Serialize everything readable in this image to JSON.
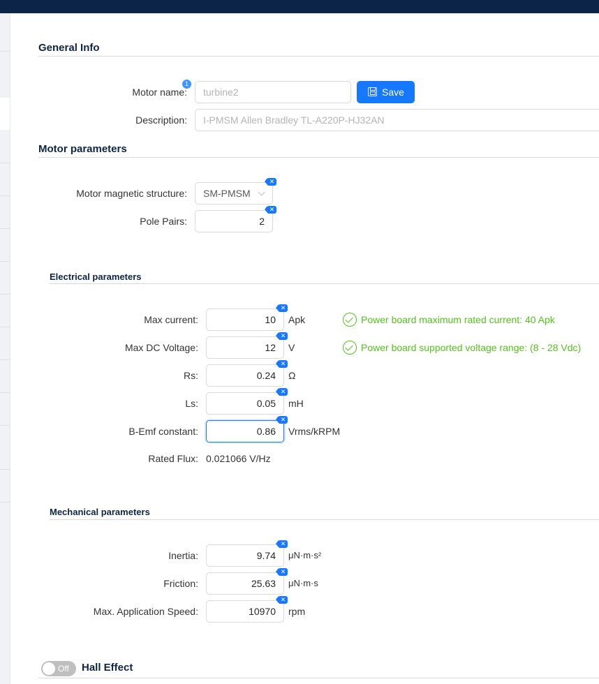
{
  "general": {
    "title": "General Info",
    "motor_name_label": "Motor name:",
    "motor_name_badge": "1",
    "motor_name_placeholder": "turbine2",
    "save_label": "Save",
    "description_label": "Description:",
    "description_placeholder": "I-PMSM Allen Bradley TL-A220P-HJ32AN"
  },
  "motor": {
    "title": "Motor parameters",
    "structure_label": "Motor magnetic structure:",
    "structure_value": "SM-PMSM",
    "pole_pairs_label": "Pole Pairs:",
    "pole_pairs_value": "2"
  },
  "electrical": {
    "title": "Electrical parameters",
    "max_current_label": "Max current:",
    "max_current_value": "10",
    "max_current_unit": "Apk",
    "max_current_msg": "Power board maximum rated current: 40 Apk",
    "max_voltage_label": "Max DC Voltage:",
    "max_voltage_value": "12",
    "max_voltage_unit": "V",
    "max_voltage_msg": "Power board supported voltage range: (8 - 28 Vdc)",
    "rs_label": "Rs:",
    "rs_value": "0.24",
    "rs_unit": "Ω",
    "ls_label": "Ls:",
    "ls_value": "0.05",
    "ls_unit": "mH",
    "bemf_label": "B-Emf constant:",
    "bemf_value": "0.86",
    "bemf_unit": "Vrms/kRPM",
    "rated_flux_label": "Rated Flux:",
    "rated_flux_value": "0.021066 V/Hz"
  },
  "mechanical": {
    "title": "Mechanical parameters",
    "inertia_label": "Inertia:",
    "inertia_value": "9.74",
    "inertia_unit": "μN·m·s²",
    "friction_label": "Friction:",
    "friction_value": "25.63",
    "friction_unit": "μN·m·s",
    "speed_label": "Max. Application Speed:",
    "speed_value": "10970",
    "speed_unit": "rpm"
  },
  "hall": {
    "toggle_label": "Off",
    "title": "Hall Effect"
  },
  "reset_glyph": "✕",
  "colors": {
    "primary": "#1677ff",
    "success": "#52c41a",
    "header": "#0c2447"
  }
}
